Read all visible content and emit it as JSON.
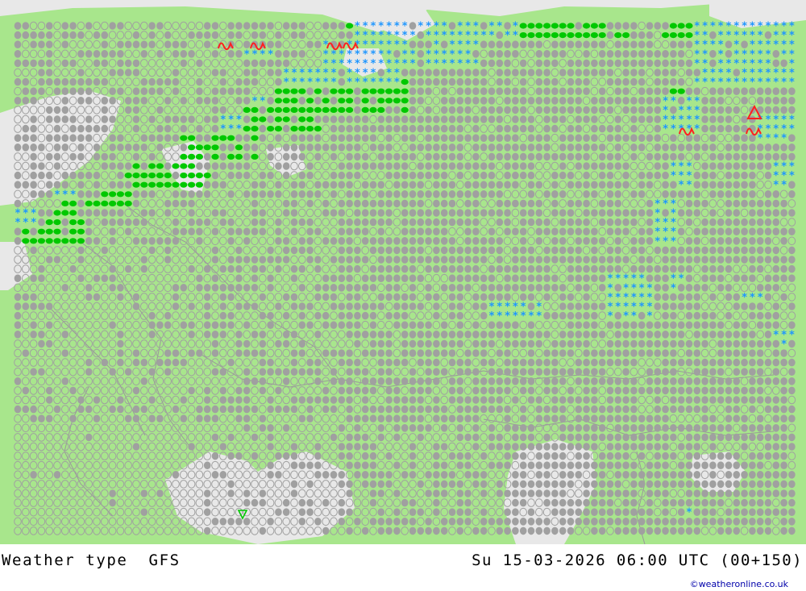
{
  "title": "Weather type",
  "model": "GFS",
  "valid_time": "Su 15-03-2026 06:00 UTC (00+150)",
  "credit": "©weatheronline.co.uk",
  "colors": {
    "land": "#a8e68c",
    "sea": "#e8e8e8",
    "border": "#999999",
    "symbol_gray": "#a0a0a0",
    "rain_green": "#00c800",
    "snow_blue": "#1e96ff",
    "thunder_red": "#ff2020"
  },
  "symbols": [
    {
      "type": "overcast",
      "icon": "filled-gray-dot-icon"
    },
    {
      "type": "cloudy",
      "icon": "outlined-gray-dot-icon"
    },
    {
      "type": "rain",
      "icon": "green-drop-icon"
    },
    {
      "type": "snow",
      "icon": "blue-asterisk-icon"
    },
    {
      "type": "fog",
      "icon": "red-fog-icon"
    },
    {
      "type": "thunderstorm",
      "icon": "red-triangle-icon"
    },
    {
      "type": "shower",
      "icon": "green-triangle-icon"
    }
  ]
}
